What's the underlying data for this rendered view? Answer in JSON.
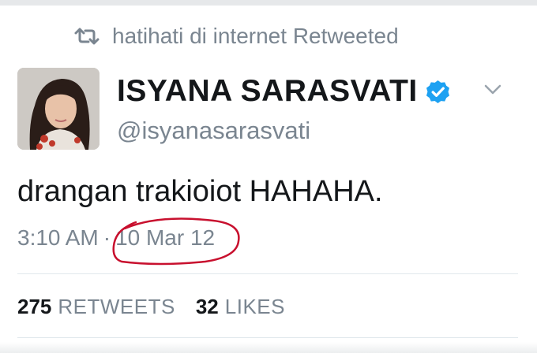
{
  "retweet_context": {
    "text": "hatihati di internet Retweeted",
    "icon": "retweet-icon"
  },
  "author": {
    "display_name": "ISYANA SARASVATI",
    "handle": "@isyanasarasvati",
    "verified": true,
    "verified_color": "#1da1f2"
  },
  "tweet": {
    "text": "drangan trakioiot HAHAHA.",
    "time": "3:10 AM",
    "separator": "·",
    "date": "10 Mar 12"
  },
  "annotation": {
    "type": "hand-drawn circle around date",
    "color": "#c8102e"
  },
  "stats": {
    "retweets": {
      "count": "275",
      "label": "RETWEETS"
    },
    "likes": {
      "count": "32",
      "label": "LIKES"
    }
  },
  "colors": {
    "text": "#14171a",
    "secondary": "#7a8590",
    "divider": "#e1e8ed"
  }
}
